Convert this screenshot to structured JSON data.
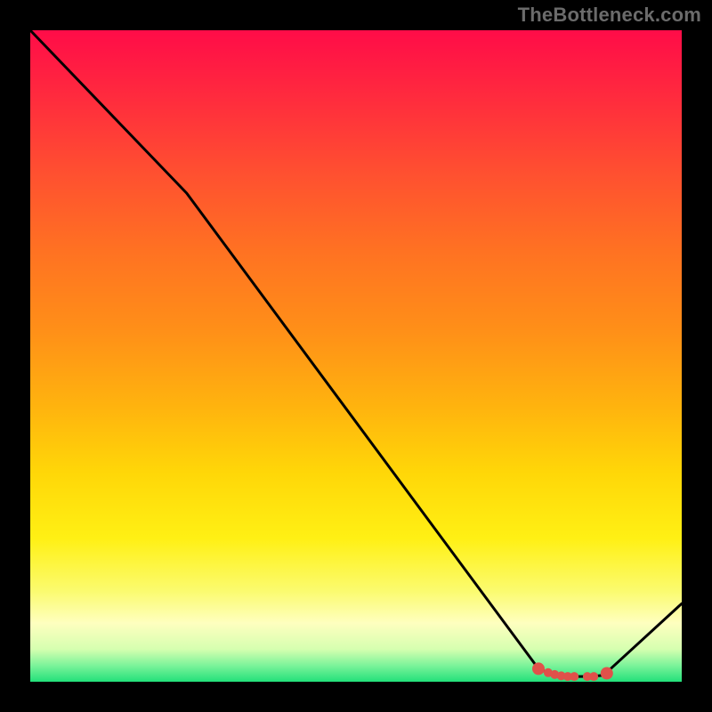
{
  "attribution": "TheBottleneck.com",
  "chart_data": {
    "type": "line",
    "title": "",
    "xlabel": "",
    "ylabel": "",
    "xlim": [
      0,
      100
    ],
    "ylim": [
      0,
      100
    ],
    "series": [
      {
        "name": "curve",
        "x": [
          0,
          24,
          78,
          81,
          86,
          88,
          100
        ],
        "y": [
          100,
          75,
          2,
          0.8,
          0.8,
          1.0,
          12
        ]
      }
    ],
    "markers": {
      "name": "highlighted-points",
      "color": "#e0514a",
      "points": [
        {
          "x": 78.0,
          "y": 2.0
        },
        {
          "x": 79.5,
          "y": 1.4
        },
        {
          "x": 80.5,
          "y": 1.1
        },
        {
          "x": 81.5,
          "y": 0.9
        },
        {
          "x": 82.5,
          "y": 0.8
        },
        {
          "x": 83.5,
          "y": 0.8
        },
        {
          "x": 85.5,
          "y": 0.8
        },
        {
          "x": 86.5,
          "y": 0.8
        },
        {
          "x": 88.5,
          "y": 1.3
        }
      ]
    }
  }
}
